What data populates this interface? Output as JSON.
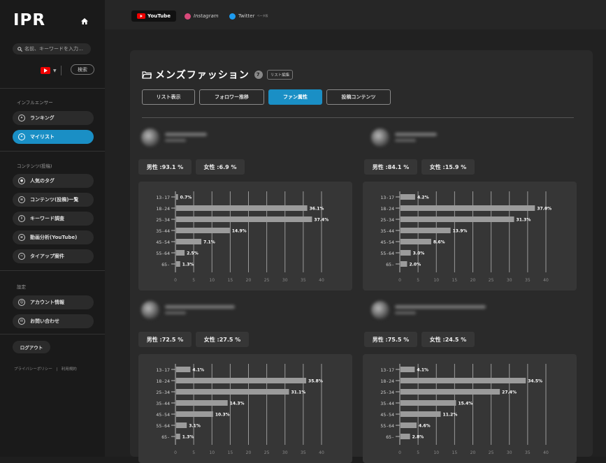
{
  "app": {
    "logo": "IPR"
  },
  "sidebar": {
    "search_placeholder": "名前、キーワードを入力…",
    "search_button": "検索",
    "section_influencer": "インフルエンサー",
    "items_influencer": [
      {
        "label": "ランキング",
        "icon": "ranking-icon",
        "active": false
      },
      {
        "label": "マイリスト",
        "icon": "mylist-icon",
        "active": true
      }
    ],
    "section_content": "コンテンツ(投稿)",
    "items_content": [
      {
        "label": "人気のタグ",
        "icon": "tag-icon"
      },
      {
        "label": "コンテンツ(投稿)一覧",
        "icon": "content-list-icon"
      },
      {
        "label": "キーワード調査",
        "icon": "keyword-icon"
      },
      {
        "label": "動画分析(YouTube)",
        "icon": "video-analysis-icon"
      },
      {
        "label": "タイアップ案件",
        "icon": "tieup-icon"
      }
    ],
    "section_settings": "設定",
    "items_settings": [
      {
        "label": "アカウント情報",
        "icon": "account-icon"
      },
      {
        "label": "お問い合わせ",
        "icon": "contact-icon"
      }
    ],
    "logout": "ログアウト",
    "footer": "プライバシーポリシー　|　利用規約"
  },
  "topbar": {
    "tabs": [
      {
        "label": "YouTube",
        "active": true,
        "color": "#e00000"
      },
      {
        "label": "Instagram",
        "active": false,
        "color": "#d9497a"
      },
      {
        "label": "Twitter",
        "active": false,
        "color": "#1d9bf0",
        "badge": "ベータ版"
      }
    ]
  },
  "panel": {
    "title": "メンズファッション",
    "count": "7",
    "edit_label": "リスト編集",
    "subtabs": [
      "リスト表示",
      "フォロワー推移",
      "ファン属性",
      "投稿コンテンツ"
    ],
    "active_subtab": 2
  },
  "cards": [
    {
      "male": "男性 :93.1 %",
      "female": "女性 :6.9 %"
    },
    {
      "male": "男性 :84.1 %",
      "female": "女性 :15.9 %"
    },
    {
      "male": "男性 :72.5 %",
      "female": "女性 :27.5 %"
    },
    {
      "male": "男性 :75.5 %",
      "female": "女性 :24.5 %"
    }
  ],
  "chart_data": [
    {
      "type": "bar",
      "orientation": "horizontal",
      "categories": [
        "13-17",
        "18-24",
        "25-34",
        "35-44",
        "45-54",
        "55-64",
        "65-"
      ],
      "values": [
        0.7,
        36.1,
        37.4,
        14.9,
        7.1,
        2.5,
        1.3
      ],
      "labels": [
        "0.7%",
        "36.1%",
        "37.4%",
        "14.9%",
        "7.1%",
        "2.5%",
        "1.3%"
      ],
      "xticks": [
        0,
        5,
        10,
        15,
        20,
        25,
        30,
        35,
        40
      ],
      "xlim": [
        0,
        40
      ],
      "grid": true
    },
    {
      "type": "bar",
      "orientation": "horizontal",
      "categories": [
        "13-17",
        "18-24",
        "25-34",
        "35-44",
        "45-54",
        "55-64",
        "65-"
      ],
      "values": [
        4.2,
        37.0,
        31.3,
        13.9,
        8.6,
        3.0,
        2.0
      ],
      "labels": [
        "4.2%",
        "37.0%",
        "31.3%",
        "13.9%",
        "8.6%",
        "3.0%",
        "2.0%"
      ],
      "xticks": [
        0,
        5,
        10,
        15,
        20,
        25,
        30,
        35,
        40
      ],
      "xlim": [
        0,
        40
      ],
      "grid": true
    },
    {
      "type": "bar",
      "orientation": "horizontal",
      "categories": [
        "13-17",
        "18-24",
        "25-34",
        "35-44",
        "45-54",
        "55-64",
        "65-"
      ],
      "values": [
        4.1,
        35.8,
        31.1,
        14.3,
        10.3,
        3.1,
        1.3
      ],
      "labels": [
        "4.1%",
        "35.8%",
        "31.1%",
        "14.3%",
        "10.3%",
        "3.1%",
        "1.3%"
      ],
      "xticks": [
        0,
        5,
        10,
        15,
        20,
        25,
        30,
        35,
        40
      ],
      "xlim": [
        0,
        40
      ],
      "grid": true
    },
    {
      "type": "bar",
      "orientation": "horizontal",
      "categories": [
        "13-17",
        "18-24",
        "25-34",
        "35-44",
        "45-54",
        "55-64",
        "65-"
      ],
      "values": [
        4.1,
        34.5,
        27.4,
        15.4,
        11.2,
        4.6,
        2.8
      ],
      "labels": [
        "4.1%",
        "34.5%",
        "27.4%",
        "15.4%",
        "11.2%",
        "4.6%",
        "2.8%"
      ],
      "xticks": [
        0,
        5,
        10,
        15,
        20,
        25,
        30,
        35,
        40
      ],
      "xlim": [
        0,
        40
      ],
      "grid": true
    }
  ]
}
